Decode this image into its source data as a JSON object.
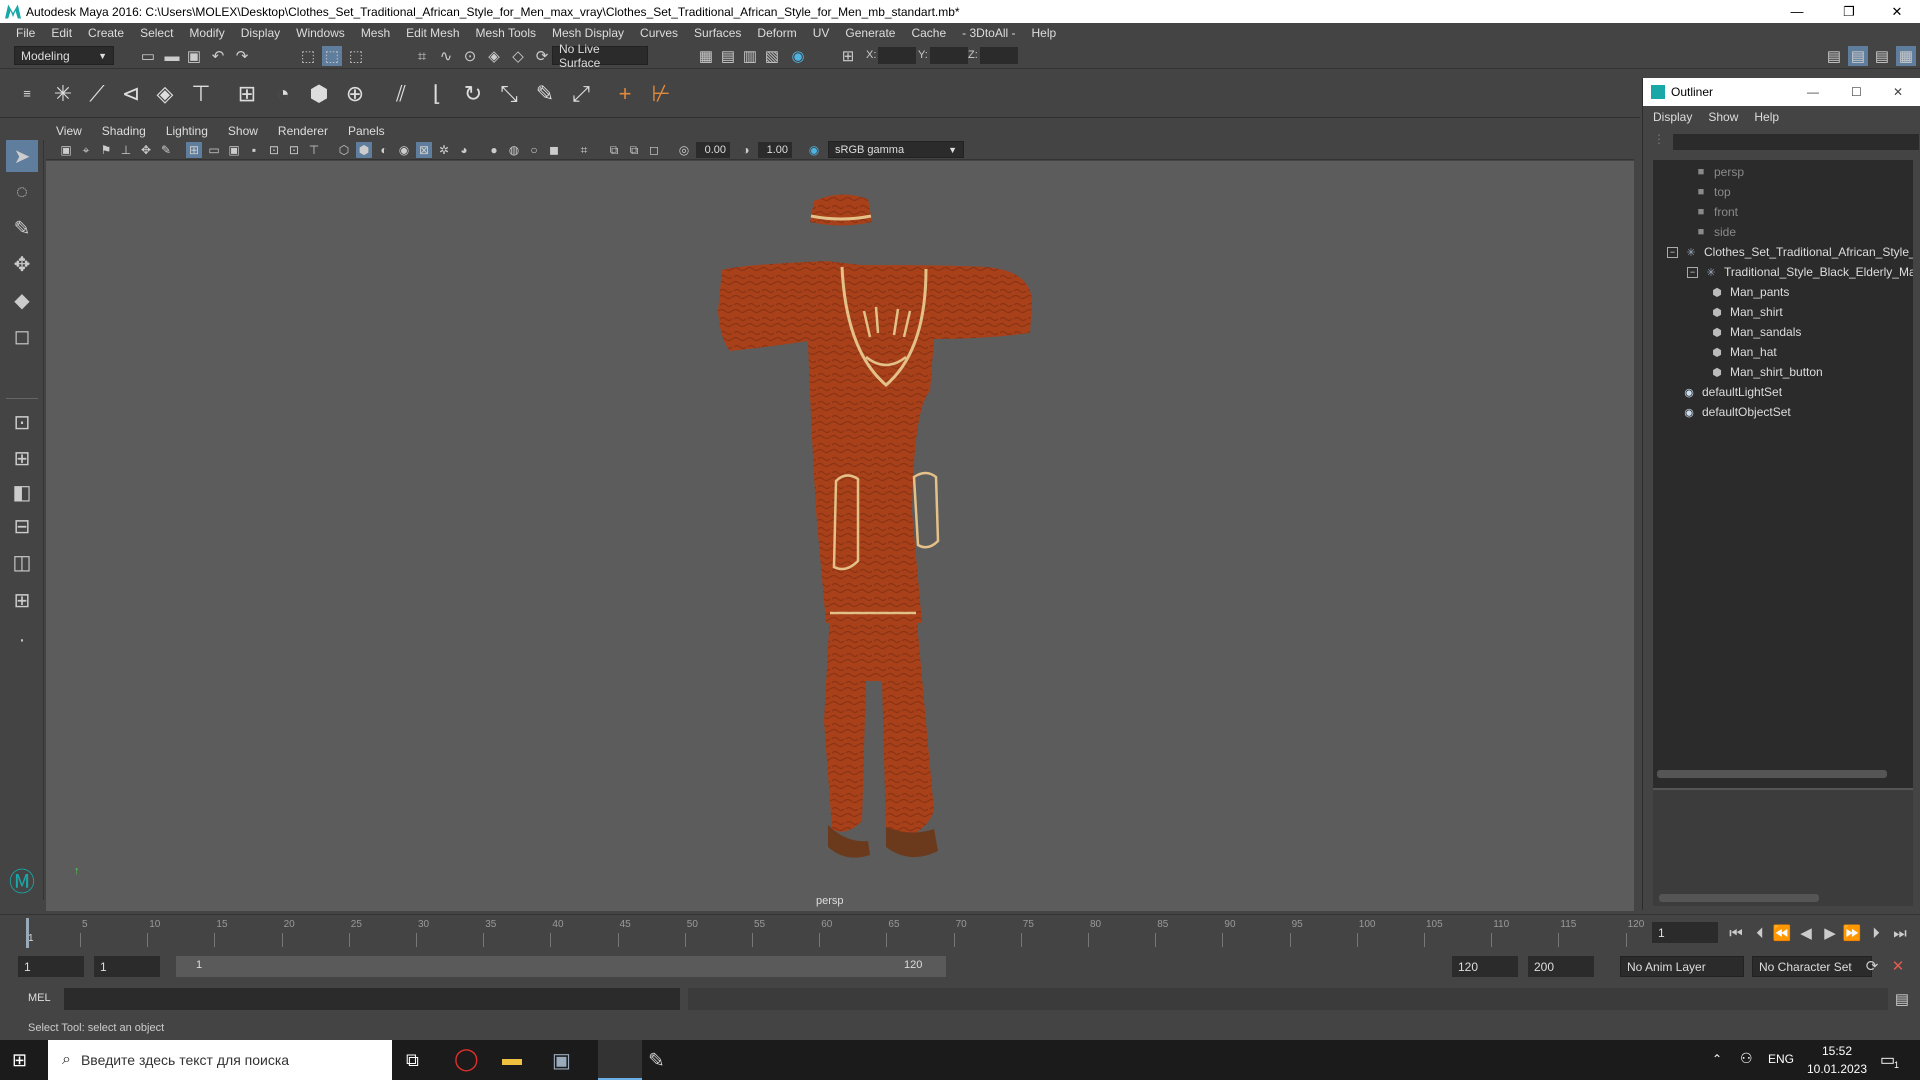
{
  "window": {
    "title": "Autodesk Maya 2016: C:\\Users\\MOLEX\\Desktop\\Clothes_Set_Traditional_African_Style_for_Men_max_vray\\Clothes_Set_Traditional_African_Style_for_Men_mb_standart.mb*",
    "minimize": "—",
    "maximize": "❐",
    "close": "✕"
  },
  "menubar": [
    "File",
    "Edit",
    "Create",
    "Select",
    "Modify",
    "Display",
    "Windows",
    "Mesh",
    "Edit Mesh",
    "Mesh Tools",
    "Mesh Display",
    "Curves",
    "Surfaces",
    "Deform",
    "UV",
    "Generate",
    "Cache",
    "- 3DtoAll -",
    "Help"
  ],
  "statusline": {
    "mode": "Modeling",
    "live_surface": "No Live Surface",
    "x_label": "X:",
    "y_label": "Y:",
    "z_label": "Z:"
  },
  "viewport": {
    "menu": [
      "View",
      "Shading",
      "Lighting",
      "Show",
      "Renderer",
      "Panels"
    ],
    "exposure": "0.00",
    "gamma": "1.00",
    "color_space": "sRGB gamma",
    "camera_label": "persp",
    "colors": {
      "cloth": "#a8401a",
      "trim": "#e3c188",
      "shoes": "#6b3a1c",
      "background": "#5c5c5c"
    }
  },
  "outliner": {
    "title": "Outliner",
    "menu": [
      "Display",
      "Show",
      "Help"
    ],
    "items": [
      {
        "label": "persp",
        "type": "camera"
      },
      {
        "label": "top",
        "type": "camera"
      },
      {
        "label": "front",
        "type": "camera"
      },
      {
        "label": "side",
        "type": "camera"
      },
      {
        "label": "Clothes_Set_Traditional_African_Style_f",
        "type": "group"
      },
      {
        "label": "Traditional_Style_Black_Elderly_Mar",
        "type": "group"
      },
      {
        "label": "Man_pants",
        "type": "mesh"
      },
      {
        "label": "Man_shirt",
        "type": "mesh"
      },
      {
        "label": "Man_sandals",
        "type": "mesh"
      },
      {
        "label": "Man_hat",
        "type": "mesh"
      },
      {
        "label": "Man_shirt_button",
        "type": "mesh"
      },
      {
        "label": "defaultLightSet",
        "type": "set"
      },
      {
        "label": "defaultObjectSet",
        "type": "set"
      }
    ]
  },
  "timeline": {
    "ticks": [
      "5",
      "10",
      "15",
      "20",
      "25",
      "30",
      "35",
      "40",
      "45",
      "50",
      "55",
      "60",
      "65",
      "70",
      "75",
      "80",
      "85",
      "90",
      "95",
      "100",
      "105",
      "110",
      "115",
      "120"
    ],
    "start_tick": "1",
    "current_frame": "1"
  },
  "range": {
    "start": "1",
    "playback_start": "1",
    "slider_start": "1",
    "slider_end": "120",
    "playback_end": "120",
    "end": "200",
    "anim_layer": "No Anim Layer",
    "character_set": "No Character Set"
  },
  "command": {
    "label": "MEL"
  },
  "help_line": "Select Tool: select an object",
  "taskbar": {
    "search_placeholder": "Введите здесь текст для поиска",
    "language": "ENG",
    "time": "15:52",
    "date": "10.01.2023",
    "notifications": "1"
  }
}
